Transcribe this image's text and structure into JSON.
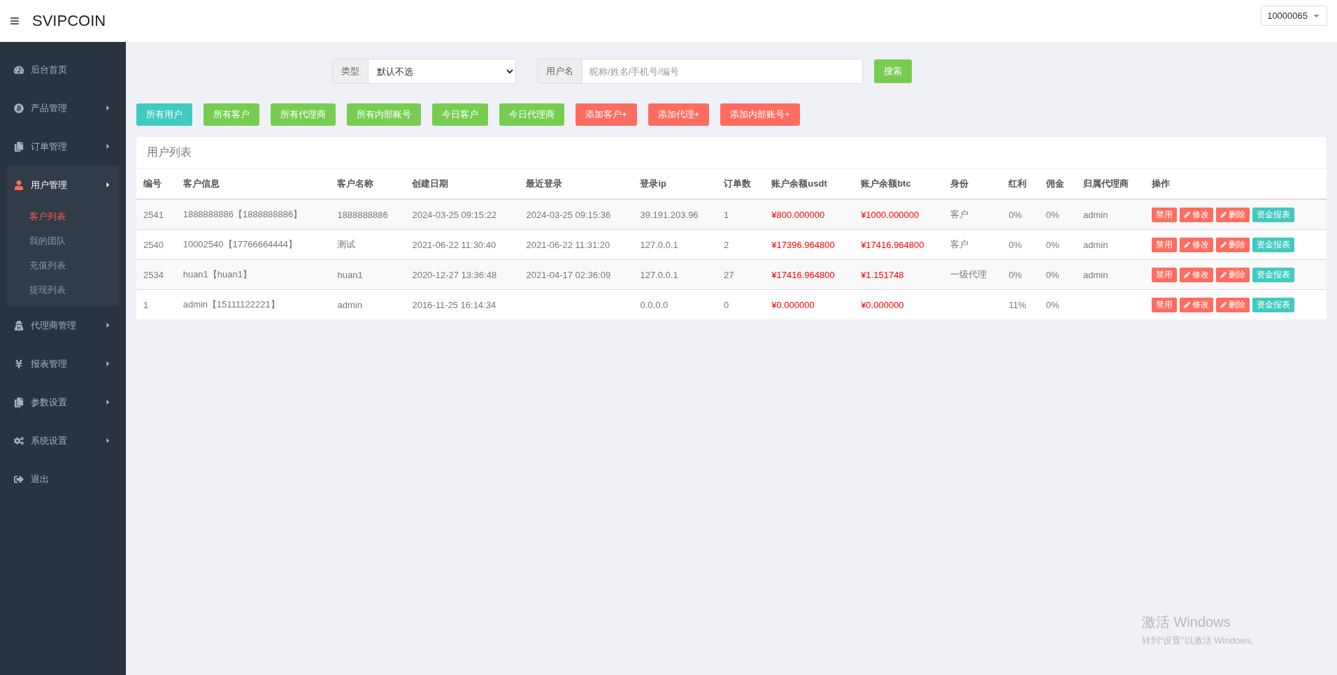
{
  "header": {
    "menu_icon": "≡",
    "brand": "SVIPCOIN",
    "user": "10000065"
  },
  "sidebar": {
    "items": [
      {
        "kind": "link",
        "label": "后台首页",
        "selected": false
      },
      {
        "kind": "menu",
        "label": "产品管理",
        "selected": false
      },
      {
        "kind": "menu",
        "label": "订单管理",
        "selected": false
      },
      {
        "kind": "menu",
        "label": "用户管理",
        "selected": true,
        "children": [
          {
            "label": "客户列表",
            "selected": true
          },
          {
            "label": "我的团队",
            "selected": false
          },
          {
            "label": "充值列表",
            "selected": false
          },
          {
            "label": "提现列表",
            "selected": false
          }
        ]
      },
      {
        "kind": "menu",
        "label": "代理商管理",
        "selected": false
      },
      {
        "kind": "menu",
        "label": "报表管理",
        "selected": false
      },
      {
        "kind": "menu",
        "label": "参数设置",
        "selected": false
      },
      {
        "kind": "menu",
        "label": "系统设置",
        "selected": false
      },
      {
        "kind": "link",
        "label": "退出",
        "selected": false
      }
    ]
  },
  "filters": {
    "type_label": "类型",
    "type_value": "默认不选",
    "user_label": "用户名",
    "user_placeholder": "昵称/姓名/手机号/编号",
    "search_button": "搜索"
  },
  "quick_buttons": [
    {
      "label": "所有用户",
      "kind": "info"
    },
    {
      "label": "所有客户",
      "kind": "success"
    },
    {
      "label": "所有代理商",
      "kind": "success"
    },
    {
      "label": "所有内部账号",
      "kind": "success"
    },
    {
      "label": "今日客户",
      "kind": "success"
    },
    {
      "label": "今日代理商",
      "kind": "success"
    },
    {
      "label": "添加客户+",
      "kind": "danger"
    },
    {
      "label": "添加代理+",
      "kind": "danger"
    },
    {
      "label": "添加内部账号+",
      "kind": "danger"
    }
  ],
  "panel": {
    "title": "用户列表"
  },
  "table": {
    "columns": [
      "编号",
      "客户信息",
      "客户名称",
      "创建日期",
      "最近登录",
      "登录ip",
      "订单数",
      "账户余额usdt",
      "账户余额btc",
      "身份",
      "红利",
      "佣金",
      "归属代理商",
      "操作"
    ],
    "rows": [
      {
        "cells": [
          "2541",
          "1888888886【1888888886】",
          "1888888886",
          "2024-03-25 09:15:22",
          "2024-03-25 09:15:36",
          "39.191.203.96",
          "1",
          "¥800.000000",
          "¥1000.000000",
          "客户",
          "0%",
          "0%",
          "admin"
        ],
        "actions": [
          {
            "label": "禁用",
            "kind": "danger"
          },
          {
            "label": "修改",
            "kind": "edit"
          },
          {
            "label": "删除",
            "kind": "edit"
          },
          {
            "label": "资金报表",
            "kind": "info"
          }
        ]
      },
      {
        "cells": [
          "2540",
          "10002540【17766664444】",
          "测试",
          "2021-06-22 11:30:40",
          "2021-06-22 11:31:20",
          "127.0.0.1",
          "2",
          "¥17396.964800",
          "¥17416.964800",
          "客户",
          "0%",
          "0%",
          "admin"
        ],
        "actions": [
          {
            "label": "禁用",
            "kind": "danger"
          },
          {
            "label": "修改",
            "kind": "edit"
          },
          {
            "label": "删除",
            "kind": "edit"
          },
          {
            "label": "资金报表",
            "kind": "info"
          }
        ]
      },
      {
        "cells": [
          "2534",
          "huan1【huan1】",
          "huan1",
          "2020-12-27 13:36:48",
          "2021-04-17 02:36:09",
          "127.0.0.1",
          "27",
          "¥17416.964800",
          "¥1.151748",
          "一级代理",
          "0%",
          "0%",
          "admin"
        ],
        "actions": [
          {
            "label": "禁用",
            "kind": "danger"
          },
          {
            "label": "修改",
            "kind": "edit"
          },
          {
            "label": "删除",
            "kind": "edit"
          },
          {
            "label": "资金报表",
            "kind": "info"
          }
        ]
      },
      {
        "cells": [
          "1",
          "admin【15111122221】",
          "admin",
          "2016-11-25 16:14:34",
          "",
          "0.0.0.0",
          "0",
          "¥0.000000",
          "¥0.000000",
          "",
          "11%",
          "0%",
          ""
        ],
        "actions": [
          {
            "label": "禁用",
            "kind": "danger"
          },
          {
            "label": "修改",
            "kind": "edit"
          },
          {
            "label": "删除",
            "kind": "edit"
          },
          {
            "label": "资金报表",
            "kind": "info"
          }
        ]
      }
    ]
  },
  "os_notice": {
    "title": "激活 Windows",
    "text": "转到“设置”以激活 Windows。"
  }
}
